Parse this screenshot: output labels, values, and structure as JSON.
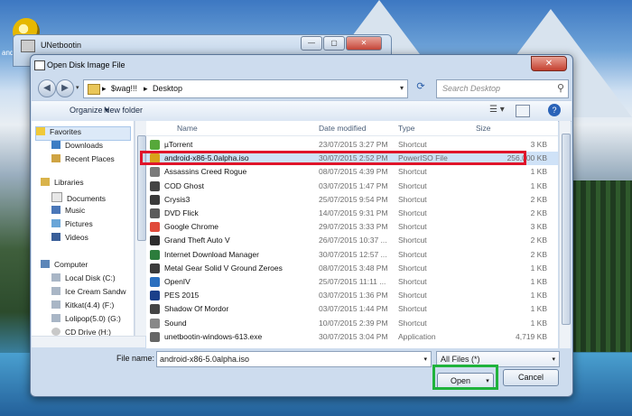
{
  "desktop": {
    "icon_label": "andr"
  },
  "unetbootin": {
    "title": "UNetbootin",
    "min": "—",
    "max": "▢",
    "close": "✕"
  },
  "dialog": {
    "title": "Open Disk Image File",
    "close": "✕",
    "breadcrumb": [
      "$wag!!!",
      "Desktop"
    ],
    "search_placeholder": "Search Desktop",
    "toolbar": {
      "organize": "Organize ▾",
      "new_folder": "New folder"
    },
    "nav": {
      "favorites": "Favorites",
      "downloads": "Downloads",
      "recent_places": "Recent Places",
      "libraries": "Libraries",
      "documents": "Documents",
      "music": "Music",
      "pictures": "Pictures",
      "videos": "Videos",
      "computer": "Computer",
      "local_disk": "Local Disk (C:)",
      "ice_cream": "Ice Cream Sandw",
      "kitkat": "Kitkat(4.4) (F:)",
      "lolipop": "Lolipop(5.0) (G:)",
      "cd_drive": "CD Drive (H:)"
    },
    "columns": {
      "name": "Name",
      "date": "Date modified",
      "type": "Type",
      "size": "Size"
    },
    "files": [
      {
        "name": "µTorrent",
        "date": "23/07/2015 3:27 PM",
        "type": "Shortcut",
        "size": "3 KB",
        "icon_color": "#56a83a"
      },
      {
        "name": "android-x86-5.0alpha.iso",
        "date": "30/07/2015 2:52 PM",
        "type": "PowerISO File",
        "size": "256,000 KB",
        "icon_color": "#d9a21b"
      },
      {
        "name": "Assassins Creed Rogue",
        "date": "08/07/2015 4:39 PM",
        "type": "Shortcut",
        "size": "1 KB",
        "icon_color": "#7a7a7a"
      },
      {
        "name": "COD Ghost",
        "date": "03/07/2015 1:47 PM",
        "type": "Shortcut",
        "size": "1 KB",
        "icon_color": "#444444"
      },
      {
        "name": "Crysis3",
        "date": "25/07/2015 9:54 PM",
        "type": "Shortcut",
        "size": "2 KB",
        "icon_color": "#3a3a3a"
      },
      {
        "name": "DVD Flick",
        "date": "14/07/2015 9:31 PM",
        "type": "Shortcut",
        "size": "2 KB",
        "icon_color": "#5a5a5a"
      },
      {
        "name": "Google Chrome",
        "date": "29/07/2015 3:33 PM",
        "type": "Shortcut",
        "size": "3 KB",
        "icon_color": "#e04a3a"
      },
      {
        "name": "Grand Theft Auto V",
        "date": "26/07/2015 10:37 ...",
        "type": "Shortcut",
        "size": "2 KB",
        "icon_color": "#2d2d2d"
      },
      {
        "name": "Internet Download Manager",
        "date": "30/07/2015 12:57 ...",
        "type": "Shortcut",
        "size": "2 KB",
        "icon_color": "#2c7d3c"
      },
      {
        "name": "Metal Gear Solid V Ground Zeroes",
        "date": "08/07/2015 3:48 PM",
        "type": "Shortcut",
        "size": "1 KB",
        "icon_color": "#3b3b3b"
      },
      {
        "name": "OpenIV",
        "date": "25/07/2015 11:11 ...",
        "type": "Shortcut",
        "size": "1 KB",
        "icon_color": "#2b6fbf"
      },
      {
        "name": "PES 2015",
        "date": "03/07/2015 1:36 PM",
        "type": "Shortcut",
        "size": "1 KB",
        "icon_color": "#1b3f8a"
      },
      {
        "name": "Shadow Of Mordor",
        "date": "03/07/2015 1:44 PM",
        "type": "Shortcut",
        "size": "1 KB",
        "icon_color": "#444444"
      },
      {
        "name": "Sound",
        "date": "10/07/2015 2:39 PM",
        "type": "Shortcut",
        "size": "1 KB",
        "icon_color": "#888888"
      },
      {
        "name": "unetbootin-windows-613.exe",
        "date": "30/07/2015 3:04 PM",
        "type": "Application",
        "size": "4,719 KB",
        "icon_color": "#666666"
      }
    ],
    "file_name_label": "File name:",
    "file_name_value": "android-x86-5.0alpha.iso",
    "file_type": "All Files (*)",
    "open_button": "Open",
    "cancel_button": "Cancel",
    "highlight_color": "#e0152a",
    "focus_color": "#1fb33c"
  }
}
